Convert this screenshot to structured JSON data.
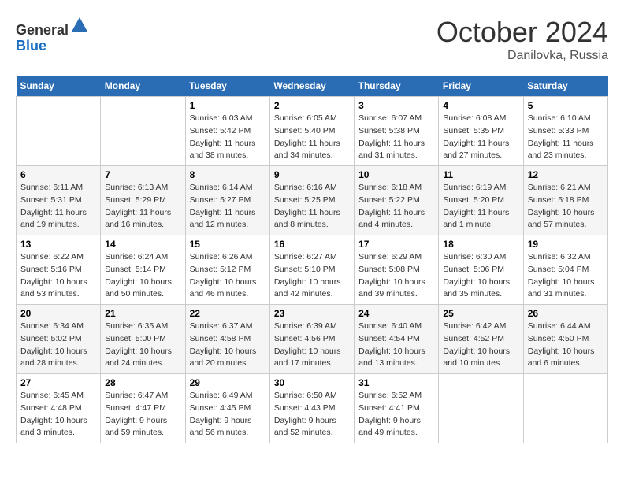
{
  "header": {
    "logo_general": "General",
    "logo_blue": "Blue",
    "month_title": "October 2024",
    "location": "Danilovka, Russia"
  },
  "columns": [
    "Sunday",
    "Monday",
    "Tuesday",
    "Wednesday",
    "Thursday",
    "Friday",
    "Saturday"
  ],
  "weeks": [
    [
      {
        "day": "",
        "info": ""
      },
      {
        "day": "",
        "info": ""
      },
      {
        "day": "1",
        "info": "Sunrise: 6:03 AM\nSunset: 5:42 PM\nDaylight: 11 hours and 38 minutes."
      },
      {
        "day": "2",
        "info": "Sunrise: 6:05 AM\nSunset: 5:40 PM\nDaylight: 11 hours and 34 minutes."
      },
      {
        "day": "3",
        "info": "Sunrise: 6:07 AM\nSunset: 5:38 PM\nDaylight: 11 hours and 31 minutes."
      },
      {
        "day": "4",
        "info": "Sunrise: 6:08 AM\nSunset: 5:35 PM\nDaylight: 11 hours and 27 minutes."
      },
      {
        "day": "5",
        "info": "Sunrise: 6:10 AM\nSunset: 5:33 PM\nDaylight: 11 hours and 23 minutes."
      }
    ],
    [
      {
        "day": "6",
        "info": "Sunrise: 6:11 AM\nSunset: 5:31 PM\nDaylight: 11 hours and 19 minutes."
      },
      {
        "day": "7",
        "info": "Sunrise: 6:13 AM\nSunset: 5:29 PM\nDaylight: 11 hours and 16 minutes."
      },
      {
        "day": "8",
        "info": "Sunrise: 6:14 AM\nSunset: 5:27 PM\nDaylight: 11 hours and 12 minutes."
      },
      {
        "day": "9",
        "info": "Sunrise: 6:16 AM\nSunset: 5:25 PM\nDaylight: 11 hours and 8 minutes."
      },
      {
        "day": "10",
        "info": "Sunrise: 6:18 AM\nSunset: 5:22 PM\nDaylight: 11 hours and 4 minutes."
      },
      {
        "day": "11",
        "info": "Sunrise: 6:19 AM\nSunset: 5:20 PM\nDaylight: 11 hours and 1 minute."
      },
      {
        "day": "12",
        "info": "Sunrise: 6:21 AM\nSunset: 5:18 PM\nDaylight: 10 hours and 57 minutes."
      }
    ],
    [
      {
        "day": "13",
        "info": "Sunrise: 6:22 AM\nSunset: 5:16 PM\nDaylight: 10 hours and 53 minutes."
      },
      {
        "day": "14",
        "info": "Sunrise: 6:24 AM\nSunset: 5:14 PM\nDaylight: 10 hours and 50 minutes."
      },
      {
        "day": "15",
        "info": "Sunrise: 6:26 AM\nSunset: 5:12 PM\nDaylight: 10 hours and 46 minutes."
      },
      {
        "day": "16",
        "info": "Sunrise: 6:27 AM\nSunset: 5:10 PM\nDaylight: 10 hours and 42 minutes."
      },
      {
        "day": "17",
        "info": "Sunrise: 6:29 AM\nSunset: 5:08 PM\nDaylight: 10 hours and 39 minutes."
      },
      {
        "day": "18",
        "info": "Sunrise: 6:30 AM\nSunset: 5:06 PM\nDaylight: 10 hours and 35 minutes."
      },
      {
        "day": "19",
        "info": "Sunrise: 6:32 AM\nSunset: 5:04 PM\nDaylight: 10 hours and 31 minutes."
      }
    ],
    [
      {
        "day": "20",
        "info": "Sunrise: 6:34 AM\nSunset: 5:02 PM\nDaylight: 10 hours and 28 minutes."
      },
      {
        "day": "21",
        "info": "Sunrise: 6:35 AM\nSunset: 5:00 PM\nDaylight: 10 hours and 24 minutes."
      },
      {
        "day": "22",
        "info": "Sunrise: 6:37 AM\nSunset: 4:58 PM\nDaylight: 10 hours and 20 minutes."
      },
      {
        "day": "23",
        "info": "Sunrise: 6:39 AM\nSunset: 4:56 PM\nDaylight: 10 hours and 17 minutes."
      },
      {
        "day": "24",
        "info": "Sunrise: 6:40 AM\nSunset: 4:54 PM\nDaylight: 10 hours and 13 minutes."
      },
      {
        "day": "25",
        "info": "Sunrise: 6:42 AM\nSunset: 4:52 PM\nDaylight: 10 hours and 10 minutes."
      },
      {
        "day": "26",
        "info": "Sunrise: 6:44 AM\nSunset: 4:50 PM\nDaylight: 10 hours and 6 minutes."
      }
    ],
    [
      {
        "day": "27",
        "info": "Sunrise: 6:45 AM\nSunset: 4:48 PM\nDaylight: 10 hours and 3 minutes."
      },
      {
        "day": "28",
        "info": "Sunrise: 6:47 AM\nSunset: 4:47 PM\nDaylight: 9 hours and 59 minutes."
      },
      {
        "day": "29",
        "info": "Sunrise: 6:49 AM\nSunset: 4:45 PM\nDaylight: 9 hours and 56 minutes."
      },
      {
        "day": "30",
        "info": "Sunrise: 6:50 AM\nSunset: 4:43 PM\nDaylight: 9 hours and 52 minutes."
      },
      {
        "day": "31",
        "info": "Sunrise: 6:52 AM\nSunset: 4:41 PM\nDaylight: 9 hours and 49 minutes."
      },
      {
        "day": "",
        "info": ""
      },
      {
        "day": "",
        "info": ""
      }
    ]
  ]
}
